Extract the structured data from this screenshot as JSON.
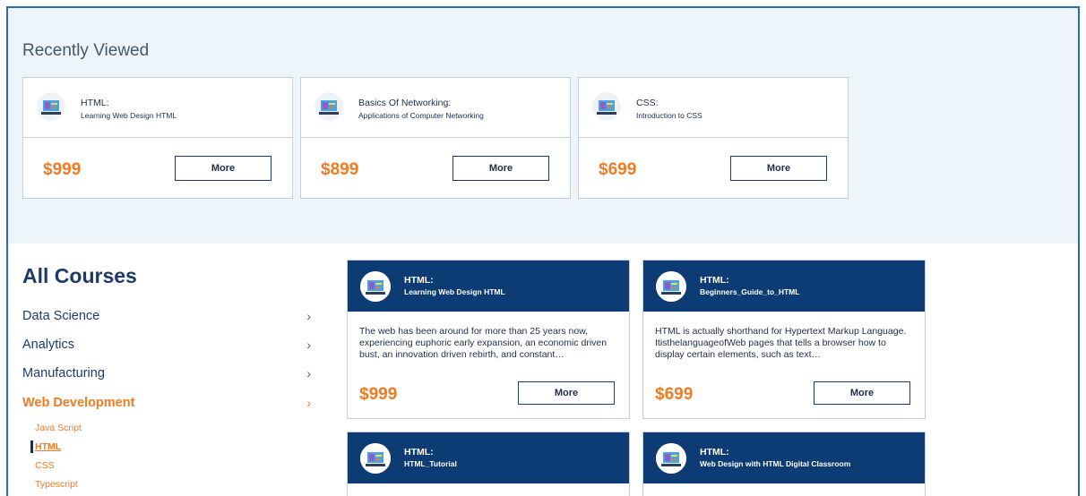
{
  "recently_viewed": {
    "title": "Recently Viewed",
    "cards": [
      {
        "title": "HTML:",
        "subtitle": "Learning Web Design HTML",
        "price": "$999",
        "more_label": "More"
      },
      {
        "title": "Basics Of Networking:",
        "subtitle": "Applications of Computer Networking",
        "price": "$899",
        "more_label": "More"
      },
      {
        "title": "CSS:",
        "subtitle": "Introduction to CSS",
        "price": "$699",
        "more_label": "More"
      }
    ]
  },
  "all_courses": {
    "title": "All Courses",
    "categories": [
      {
        "label": "Data Science",
        "chevron": "›"
      },
      {
        "label": "Analytics",
        "chevron": "›"
      },
      {
        "label": "Manufacturing",
        "chevron": "›"
      },
      {
        "label": "Web Development",
        "chevron": "›",
        "active": true
      }
    ],
    "subcategories": [
      {
        "label": "Java Script"
      },
      {
        "label": "HTML",
        "selected": true
      },
      {
        "label": "CSS"
      },
      {
        "label": "Typescript"
      }
    ]
  },
  "courses": [
    {
      "title": "HTML:",
      "subtitle": "Learning Web Design HTML",
      "description": "The web has been around for more than 25 years now, experiencing euphoric early expansion, an economic driven bust, an innovation driven rebirth, and constant…",
      "price": "$999",
      "more_label": "More"
    },
    {
      "title": "HTML:",
      "subtitle": "Beginners_Guide_to_HTML",
      "description": "HTML is actually shorthand for Hypertext Markup Language. ItisthelanguageofWeb pages that tells a browser how to display certain elements, such as text…",
      "price": "$699",
      "more_label": "More"
    },
    {
      "title": "HTML:",
      "subtitle": "HTML_Tutorial",
      "description": "",
      "price": "",
      "more_label": ""
    },
    {
      "title": "HTML:",
      "subtitle": "Web Design with HTML Digital Classroom",
      "description": "",
      "price": "",
      "more_label": ""
    }
  ],
  "colors": {
    "accent": "#f07b22",
    "navy": "#0d3b73",
    "border": "#2a6ab3"
  }
}
